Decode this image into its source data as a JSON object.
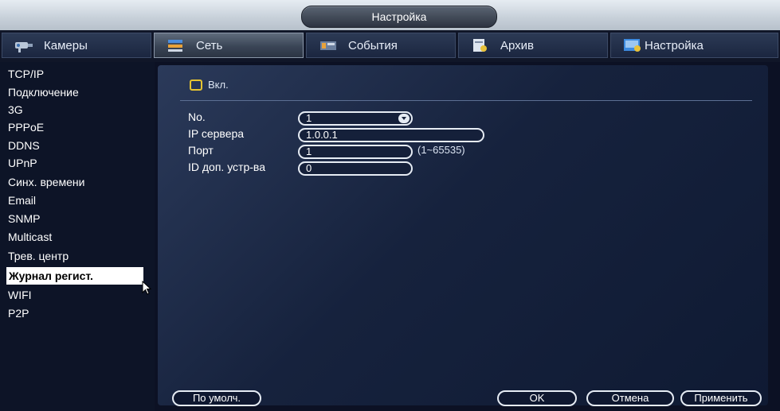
{
  "window": {
    "title": "Настройка"
  },
  "tabs": [
    {
      "label": "Камеры",
      "icon": "camera-icon"
    },
    {
      "label": "Сеть",
      "icon": "network-icon"
    },
    {
      "label": "События",
      "icon": "events-icon"
    },
    {
      "label": "Архив",
      "icon": "archive-icon"
    },
    {
      "label": "Настройка",
      "icon": "settings-icon"
    }
  ],
  "active_tab": "Сеть",
  "sidebar": {
    "items": [
      {
        "label": "TCP/IP"
      },
      {
        "label": "Подключение"
      },
      {
        "label": "3G"
      },
      {
        "label": "PPPoE"
      },
      {
        "label": "DDNS"
      },
      {
        "label": "UPnP"
      },
      {
        "label": "Синх. времени"
      },
      {
        "label": "Email"
      },
      {
        "label": "SNMP"
      },
      {
        "label": "Multicast"
      },
      {
        "label": "Трев. центр"
      },
      {
        "label": "Журнал регист."
      },
      {
        "label": "WIFI"
      },
      {
        "label": "P2P"
      }
    ],
    "selected": "Журнал регист."
  },
  "form": {
    "enable_label": "Вкл.",
    "enable_checked": false,
    "no_label": "No.",
    "no_value": "1",
    "ip_label": "IP сервера",
    "ip_value": "1.0.0.1",
    "port_label": "Порт",
    "port_value": "1",
    "port_range": "(1~65535)",
    "device_id_label": "ID доп. устр-ва",
    "device_id_value": "0"
  },
  "buttons": {
    "default": "По умолч.",
    "ok": "OK",
    "cancel": "Отмена",
    "apply": "Применить"
  },
  "colors": {
    "checkbox_border": "#e7c531",
    "selected_item_bg": "#ffffff",
    "panel_bg": "#1b2846"
  }
}
